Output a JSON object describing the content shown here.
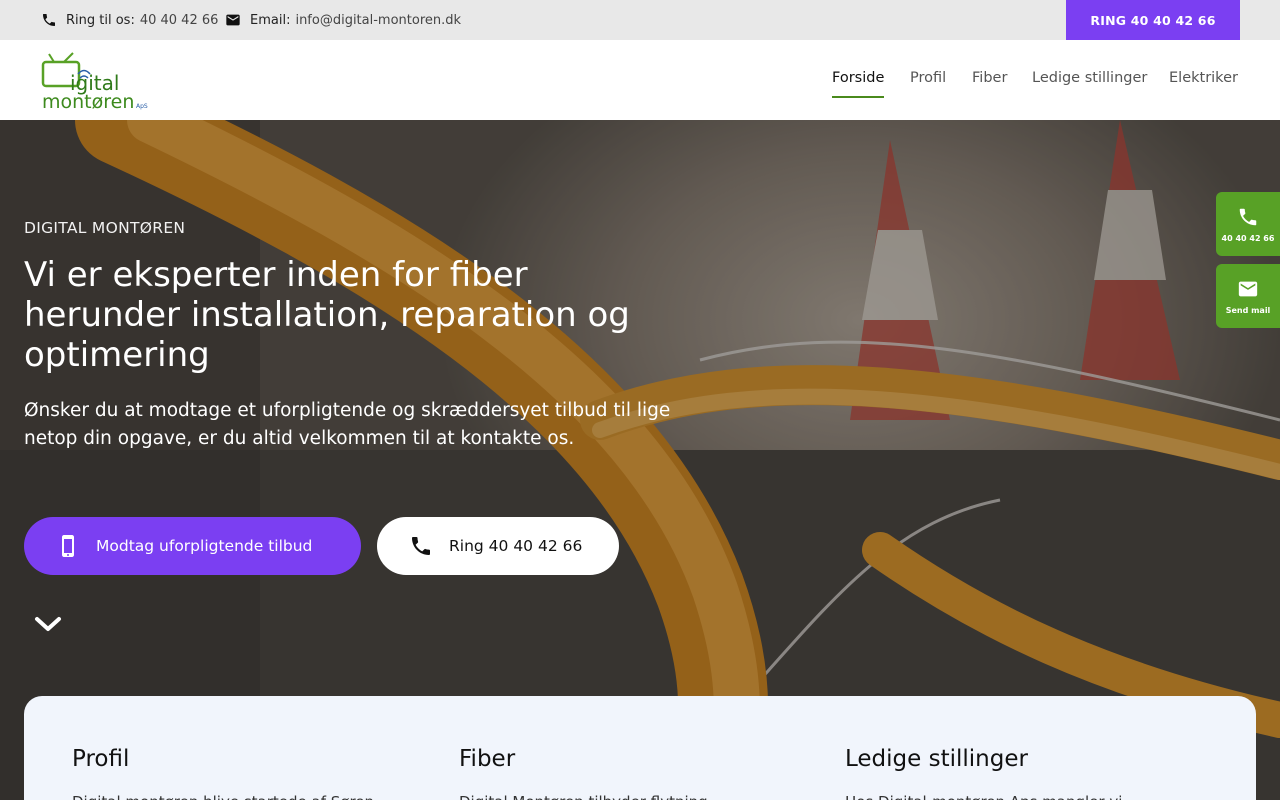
{
  "topbar": {
    "phone_label": "Ring til os:",
    "phone_value": "40 40 42 66",
    "email_label": "Email:",
    "email_value": "info@digital-montoren.dk",
    "call_button": "RING 40 40 42 66"
  },
  "header": {
    "logo_text_top": "igital",
    "logo_text_bottom": "montøren",
    "logo_suffix": "ApS",
    "nav": [
      {
        "label": "Forside",
        "active": true
      },
      {
        "label": "Profil"
      },
      {
        "label": "Fiber"
      },
      {
        "label": "Ledige stillinger"
      },
      {
        "label": "Elektriker"
      }
    ]
  },
  "hero": {
    "eyebrow": "DIGITAL MONTØREN",
    "headline": "Vi er eksperter inden for fiber herunder installation, reparation og optimering",
    "lead": "Ønsker du at modtage et uforpligtende og skræddersyet tilbud til lige netop din opgave, er du altid velkommen til at kontakte os.",
    "primary_button": "Modtag uforpligtende tilbud",
    "secondary_button": "Ring 40 40 42 66"
  },
  "floating": {
    "call_label": "40 40 42 66",
    "mail_label": "Send mail"
  },
  "cards": [
    {
      "title": "Profil",
      "text": "Digital montøren blive startede af Søren"
    },
    {
      "title": "Fiber",
      "text": "Digital Montøren tilbyder flytning"
    },
    {
      "title": "Ledige stillinger",
      "text": "Hos Digital-montøren Aps mangler vi"
    }
  ],
  "colors": {
    "accent": "#7b3ff2",
    "brand_green": "#58a126"
  },
  "icons": [
    "phone-icon",
    "mail-icon",
    "mobile-icon",
    "chevron-down-icon"
  ]
}
